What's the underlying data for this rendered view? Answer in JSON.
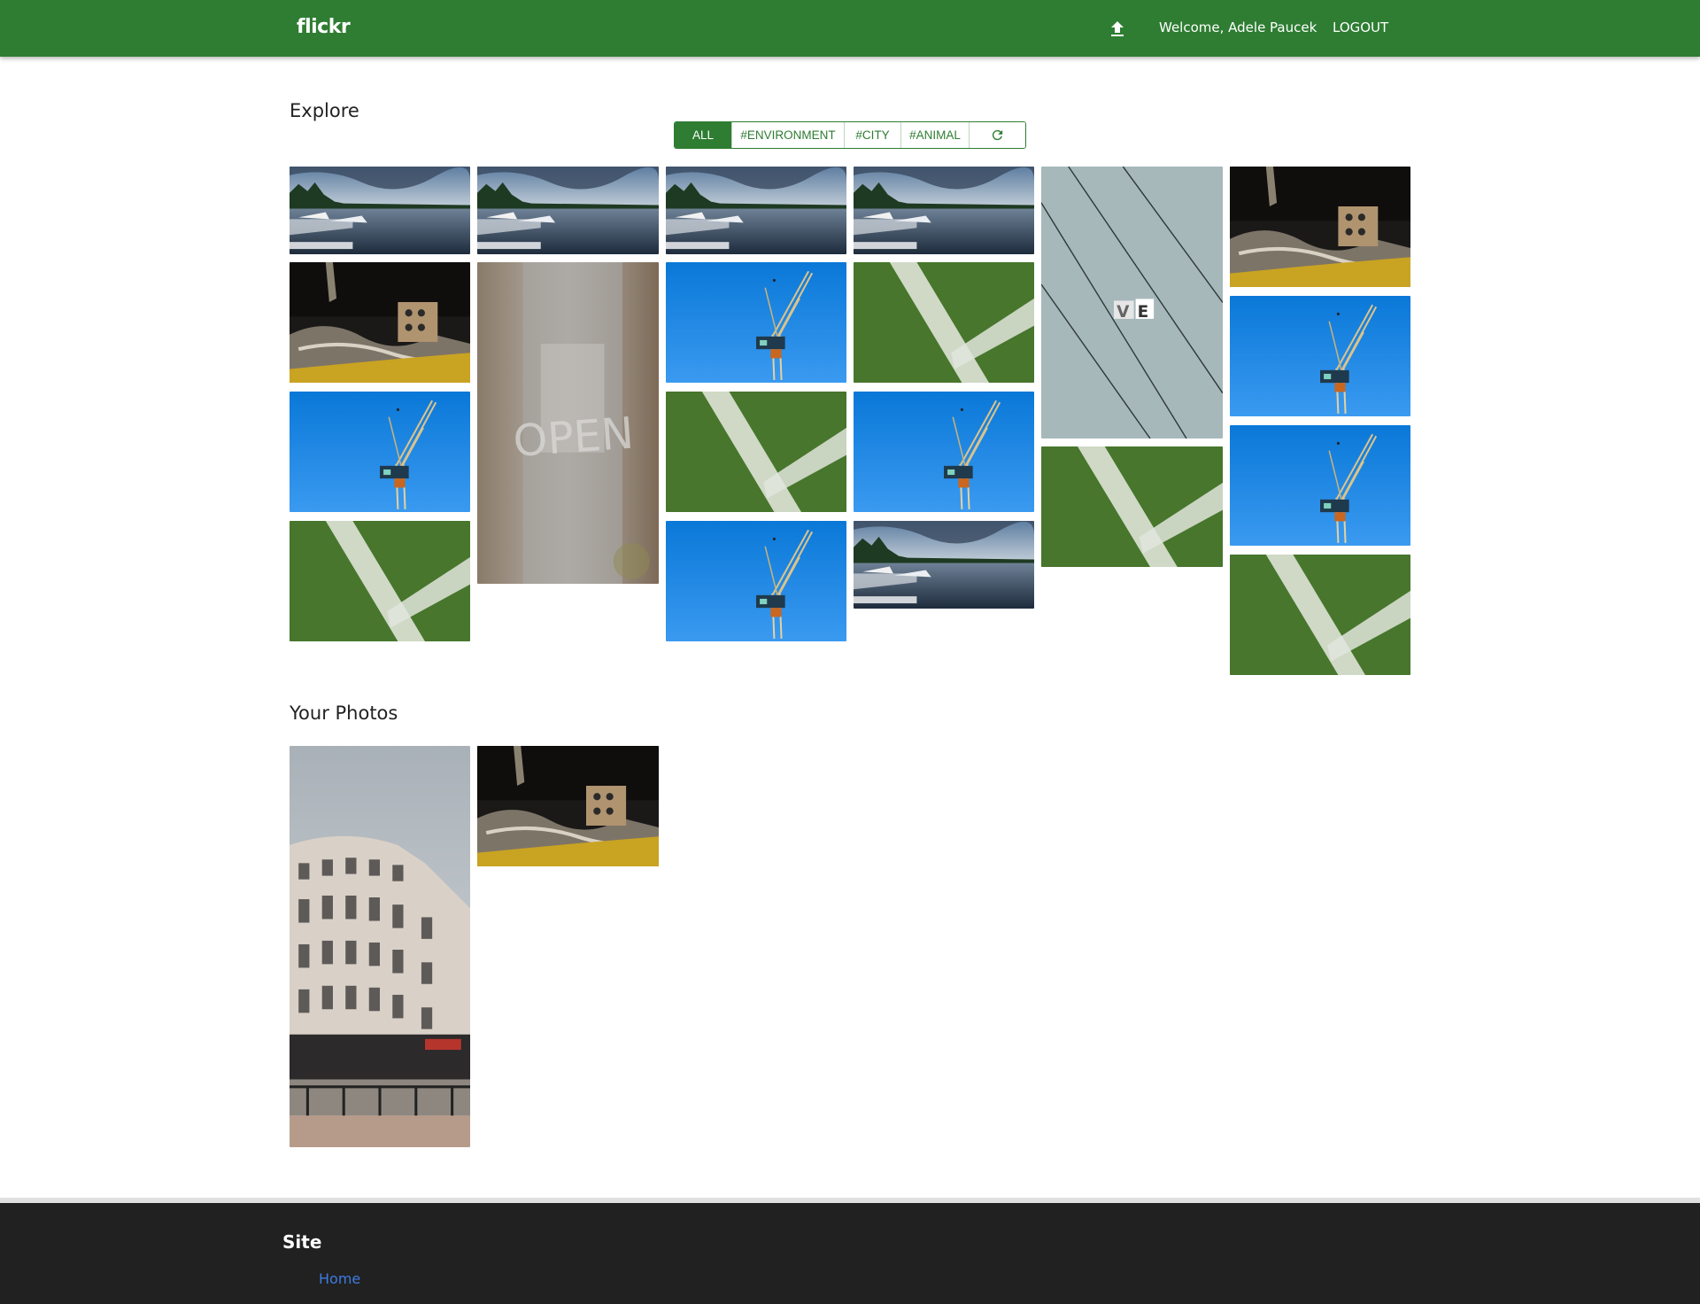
{
  "header": {
    "brand": "flickr",
    "upload_icon": "upload-icon",
    "welcome": "Welcome, Adele Paucek",
    "logout": "LOGOUT",
    "color": "#2e7d32"
  },
  "explore": {
    "title": "Explore",
    "filters": [
      {
        "label": "ALL",
        "active": true
      },
      {
        "label": "#ENVIRONMENT",
        "active": false
      },
      {
        "label": "#CITY",
        "active": false
      },
      {
        "label": "#ANIMAL",
        "active": false
      }
    ],
    "refresh_icon": "refresh-icon",
    "columns": [
      [
        "lake",
        "debris",
        "crane",
        "grass"
      ],
      [
        "lake",
        "open-sign"
      ],
      [
        "lake",
        "crane",
        "grass",
        "crane"
      ],
      [
        "lake",
        "grass",
        "crane",
        "lake"
      ],
      [
        "wall-sign",
        "grass"
      ],
      [
        "debris",
        "crane",
        "crane",
        "grass"
      ]
    ]
  },
  "your_photos": {
    "title": "Your Photos",
    "photos": [
      "building",
      "debris"
    ]
  },
  "footer": {
    "title": "Site",
    "link": "Home",
    "link_color": "#3d7be0"
  }
}
